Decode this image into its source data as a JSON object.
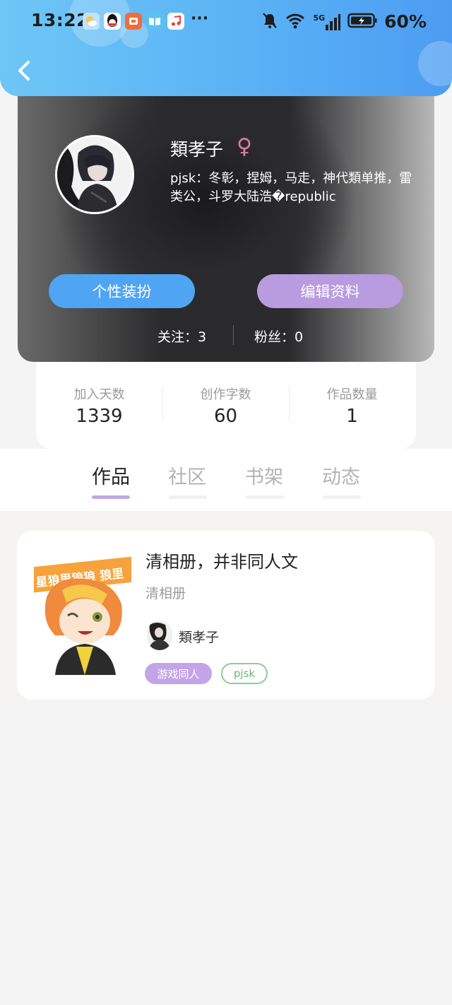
{
  "status_bar": {
    "time": "13:22",
    "app_icons": [
      "weather-icon",
      "qq-icon",
      "shopping-icon",
      "reader-icon",
      "music-icon"
    ],
    "more": "···",
    "network": "5G",
    "battery": "60%"
  },
  "profile": {
    "username": "類孝子",
    "gender": "♀",
    "bio": "pjsk：冬彰，捏姆，马走，神代類单推，雷类公，斗罗大陆浩�republic"
  },
  "buttons": {
    "decor": "个性装扮",
    "edit": "编辑资料"
  },
  "follow": {
    "following": "关注：3",
    "fans": "粉丝：0"
  },
  "stats": [
    {
      "label": "加入天数",
      "value": "1339"
    },
    {
      "label": "创作字数",
      "value": "60"
    },
    {
      "label": "作品数量",
      "value": "1"
    }
  ],
  "tabs": [
    {
      "label": "作品",
      "active": true
    },
    {
      "label": "社区",
      "active": false
    },
    {
      "label": "书架",
      "active": false
    },
    {
      "label": "动态",
      "active": false
    }
  ],
  "works": [
    {
      "title": "清相册，并非同人文",
      "subtitle": "清相册",
      "author": "類孝子",
      "cover_text": "星狼里狼狼 狼里",
      "tags": [
        "游戏同人",
        "pjsk"
      ]
    }
  ],
  "colors": {
    "header": "#5ab2f5",
    "decor_button": "#4fa5f4",
    "edit_button": "#b99be0",
    "active_tab_underline": "#c2a8e6",
    "gender": "#e07ba0"
  }
}
